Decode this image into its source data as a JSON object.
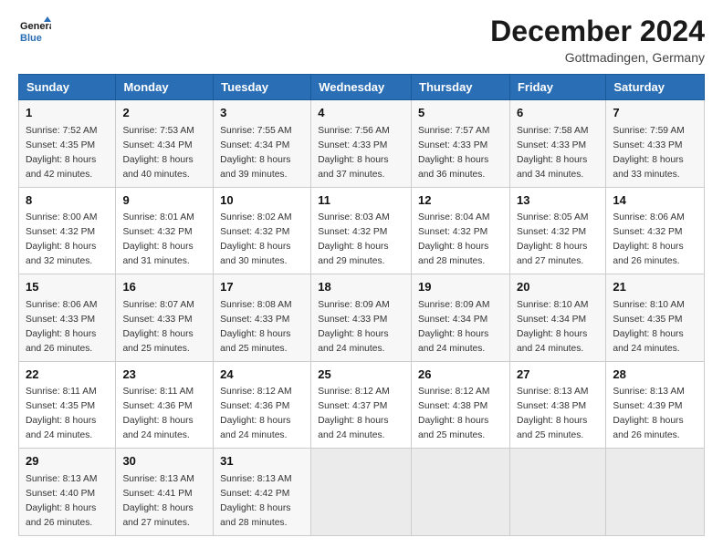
{
  "header": {
    "logo_line1": "General",
    "logo_line2": "Blue",
    "month": "December 2024",
    "location": "Gottmadingen, Germany"
  },
  "weekdays": [
    "Sunday",
    "Monday",
    "Tuesday",
    "Wednesday",
    "Thursday",
    "Friday",
    "Saturday"
  ],
  "weeks": [
    [
      {
        "day": "1",
        "sunrise": "Sunrise: 7:52 AM",
        "sunset": "Sunset: 4:35 PM",
        "daylight": "Daylight: 8 hours and 42 minutes."
      },
      {
        "day": "2",
        "sunrise": "Sunrise: 7:53 AM",
        "sunset": "Sunset: 4:34 PM",
        "daylight": "Daylight: 8 hours and 40 minutes."
      },
      {
        "day": "3",
        "sunrise": "Sunrise: 7:55 AM",
        "sunset": "Sunset: 4:34 PM",
        "daylight": "Daylight: 8 hours and 39 minutes."
      },
      {
        "day": "4",
        "sunrise": "Sunrise: 7:56 AM",
        "sunset": "Sunset: 4:33 PM",
        "daylight": "Daylight: 8 hours and 37 minutes."
      },
      {
        "day": "5",
        "sunrise": "Sunrise: 7:57 AM",
        "sunset": "Sunset: 4:33 PM",
        "daylight": "Daylight: 8 hours and 36 minutes."
      },
      {
        "day": "6",
        "sunrise": "Sunrise: 7:58 AM",
        "sunset": "Sunset: 4:33 PM",
        "daylight": "Daylight: 8 hours and 34 minutes."
      },
      {
        "day": "7",
        "sunrise": "Sunrise: 7:59 AM",
        "sunset": "Sunset: 4:33 PM",
        "daylight": "Daylight: 8 hours and 33 minutes."
      }
    ],
    [
      {
        "day": "8",
        "sunrise": "Sunrise: 8:00 AM",
        "sunset": "Sunset: 4:32 PM",
        "daylight": "Daylight: 8 hours and 32 minutes."
      },
      {
        "day": "9",
        "sunrise": "Sunrise: 8:01 AM",
        "sunset": "Sunset: 4:32 PM",
        "daylight": "Daylight: 8 hours and 31 minutes."
      },
      {
        "day": "10",
        "sunrise": "Sunrise: 8:02 AM",
        "sunset": "Sunset: 4:32 PM",
        "daylight": "Daylight: 8 hours and 30 minutes."
      },
      {
        "day": "11",
        "sunrise": "Sunrise: 8:03 AM",
        "sunset": "Sunset: 4:32 PM",
        "daylight": "Daylight: 8 hours and 29 minutes."
      },
      {
        "day": "12",
        "sunrise": "Sunrise: 8:04 AM",
        "sunset": "Sunset: 4:32 PM",
        "daylight": "Daylight: 8 hours and 28 minutes."
      },
      {
        "day": "13",
        "sunrise": "Sunrise: 8:05 AM",
        "sunset": "Sunset: 4:32 PM",
        "daylight": "Daylight: 8 hours and 27 minutes."
      },
      {
        "day": "14",
        "sunrise": "Sunrise: 8:06 AM",
        "sunset": "Sunset: 4:32 PM",
        "daylight": "Daylight: 8 hours and 26 minutes."
      }
    ],
    [
      {
        "day": "15",
        "sunrise": "Sunrise: 8:06 AM",
        "sunset": "Sunset: 4:33 PM",
        "daylight": "Daylight: 8 hours and 26 minutes."
      },
      {
        "day": "16",
        "sunrise": "Sunrise: 8:07 AM",
        "sunset": "Sunset: 4:33 PM",
        "daylight": "Daylight: 8 hours and 25 minutes."
      },
      {
        "day": "17",
        "sunrise": "Sunrise: 8:08 AM",
        "sunset": "Sunset: 4:33 PM",
        "daylight": "Daylight: 8 hours and 25 minutes."
      },
      {
        "day": "18",
        "sunrise": "Sunrise: 8:09 AM",
        "sunset": "Sunset: 4:33 PM",
        "daylight": "Daylight: 8 hours and 24 minutes."
      },
      {
        "day": "19",
        "sunrise": "Sunrise: 8:09 AM",
        "sunset": "Sunset: 4:34 PM",
        "daylight": "Daylight: 8 hours and 24 minutes."
      },
      {
        "day": "20",
        "sunrise": "Sunrise: 8:10 AM",
        "sunset": "Sunset: 4:34 PM",
        "daylight": "Daylight: 8 hours and 24 minutes."
      },
      {
        "day": "21",
        "sunrise": "Sunrise: 8:10 AM",
        "sunset": "Sunset: 4:35 PM",
        "daylight": "Daylight: 8 hours and 24 minutes."
      }
    ],
    [
      {
        "day": "22",
        "sunrise": "Sunrise: 8:11 AM",
        "sunset": "Sunset: 4:35 PM",
        "daylight": "Daylight: 8 hours and 24 minutes."
      },
      {
        "day": "23",
        "sunrise": "Sunrise: 8:11 AM",
        "sunset": "Sunset: 4:36 PM",
        "daylight": "Daylight: 8 hours and 24 minutes."
      },
      {
        "day": "24",
        "sunrise": "Sunrise: 8:12 AM",
        "sunset": "Sunset: 4:36 PM",
        "daylight": "Daylight: 8 hours and 24 minutes."
      },
      {
        "day": "25",
        "sunrise": "Sunrise: 8:12 AM",
        "sunset": "Sunset: 4:37 PM",
        "daylight": "Daylight: 8 hours and 24 minutes."
      },
      {
        "day": "26",
        "sunrise": "Sunrise: 8:12 AM",
        "sunset": "Sunset: 4:38 PM",
        "daylight": "Daylight: 8 hours and 25 minutes."
      },
      {
        "day": "27",
        "sunrise": "Sunrise: 8:13 AM",
        "sunset": "Sunset: 4:38 PM",
        "daylight": "Daylight: 8 hours and 25 minutes."
      },
      {
        "day": "28",
        "sunrise": "Sunrise: 8:13 AM",
        "sunset": "Sunset: 4:39 PM",
        "daylight": "Daylight: 8 hours and 26 minutes."
      }
    ],
    [
      {
        "day": "29",
        "sunrise": "Sunrise: 8:13 AM",
        "sunset": "Sunset: 4:40 PM",
        "daylight": "Daylight: 8 hours and 26 minutes."
      },
      {
        "day": "30",
        "sunrise": "Sunrise: 8:13 AM",
        "sunset": "Sunset: 4:41 PM",
        "daylight": "Daylight: 8 hours and 27 minutes."
      },
      {
        "day": "31",
        "sunrise": "Sunrise: 8:13 AM",
        "sunset": "Sunset: 4:42 PM",
        "daylight": "Daylight: 8 hours and 28 minutes."
      },
      null,
      null,
      null,
      null
    ]
  ]
}
